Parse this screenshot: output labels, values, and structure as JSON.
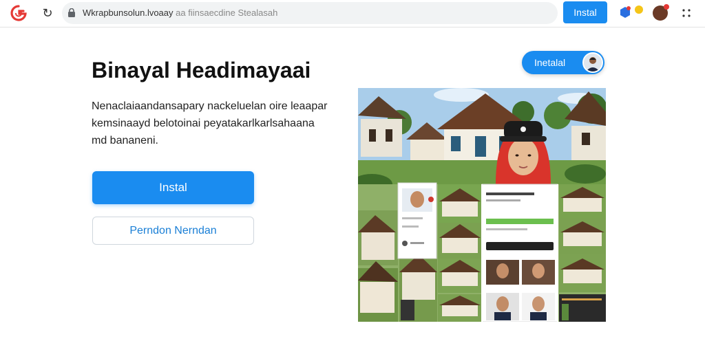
{
  "browser": {
    "url_main": "Wkrapbunsolun.lvoaay",
    "url_rest": "aa fiinsaecdine Stealasah",
    "install_label": "Instal"
  },
  "hero": {
    "title": "Binayal Headimayaai",
    "description": "Nenaclaiaandansapary nackeluelan oire leaapar kemsinaayd belotoinai peyatakarlkarlsahaana md bananeni.",
    "primary_label": "Instal",
    "secondary_label": "Perndon Nerndan"
  },
  "pill": {
    "label": "Inetalal"
  },
  "colors": {
    "accent": "#1a8cf0",
    "text": "#111111",
    "secondary_text": "#1a7fd6"
  },
  "icons": {
    "logo": "browser-logo-icon",
    "reload": "reload-icon",
    "lock": "lock-icon",
    "extension": "extension-icon",
    "menu": "kebab-menu-icon"
  }
}
